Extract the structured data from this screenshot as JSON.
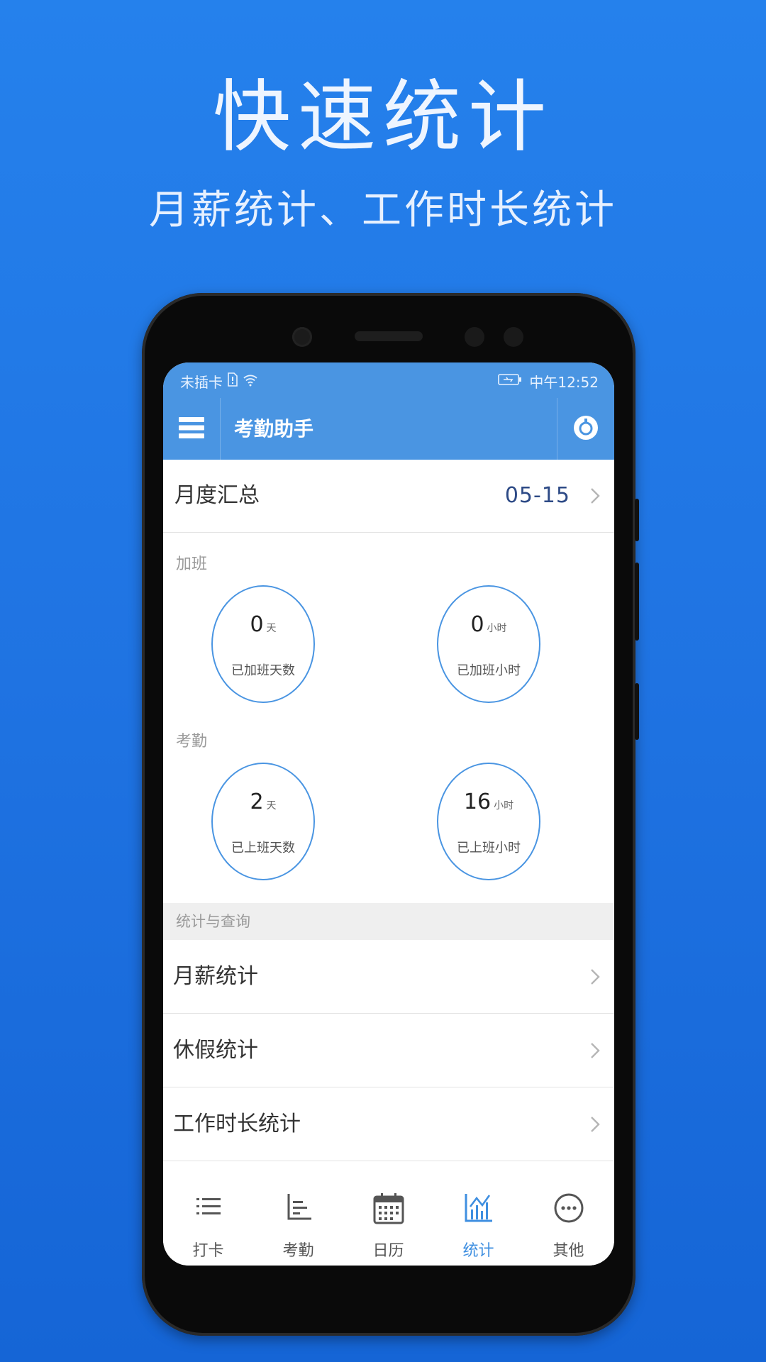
{
  "promo": {
    "title": "快速统计",
    "subtitle": "月薪统计、工作时长统计"
  },
  "status_bar": {
    "carrier": "未插卡",
    "time": "中午12:52"
  },
  "app_bar": {
    "title": "考勤助手",
    "menu_icon": "hamburger-menu-icon",
    "settings_icon": "settings-icon"
  },
  "summary": {
    "label": "月度汇总",
    "date": "05-15"
  },
  "overtime": {
    "section_label": "加班",
    "days": {
      "value": "0",
      "unit": "天",
      "caption": "已加班天数"
    },
    "hours": {
      "value": "0",
      "unit": "小时",
      "caption": "已加班小时"
    }
  },
  "attendance": {
    "section_label": "考勤",
    "days": {
      "value": "2",
      "unit": "天",
      "caption": "已上班天数"
    },
    "hours": {
      "value": "16",
      "unit": "小时",
      "caption": "已上班小时"
    }
  },
  "stats_section": {
    "header": "统计与查询",
    "items": [
      {
        "label": "月薪统计"
      },
      {
        "label": "休假统计"
      },
      {
        "label": "工作时长统计"
      }
    ]
  },
  "bottom_nav": {
    "items": [
      {
        "label": "打卡",
        "icon": "list-icon"
      },
      {
        "label": "考勤",
        "icon": "chart-axis-icon"
      },
      {
        "label": "日历",
        "icon": "calendar-icon"
      },
      {
        "label": "统计",
        "icon": "statistics-icon",
        "active": true
      },
      {
        "label": "其他",
        "icon": "more-icon"
      }
    ]
  },
  "colors": {
    "background": "#2581ec",
    "app_bar": "#4a95e2",
    "accent": "#3f8fe0",
    "date_text": "#2d4a86"
  }
}
